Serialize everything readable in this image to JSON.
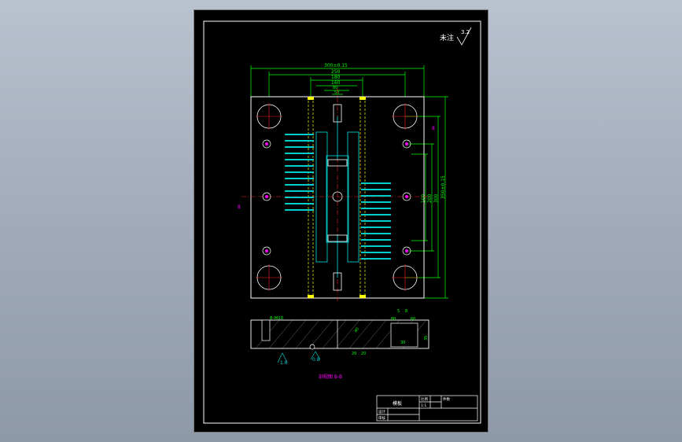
{
  "drawing": {
    "surface_note": "未注",
    "roughness_value": "3.2",
    "dimensions": {
      "overall_width": "300±0.15",
      "width_2": "250",
      "width_3": "180",
      "width_4": "160",
      "width_5": "80",
      "width_6": "50",
      "width_7": "40",
      "width_8": "20",
      "overall_height": "350±0.15",
      "height_2": "300",
      "height_3": "200",
      "height_4": "100",
      "side_8": "8",
      "offset_8": "8",
      "section_thread": "8-M10",
      "section_depth": "30",
      "section_d1": "5",
      "section_d2": "8",
      "section_d3": "80",
      "section_d4": "60",
      "section_d5": "20",
      "section_d6": "20",
      "section_d7": "40",
      "section_d8": "35"
    },
    "roughness_marks": [
      "1.6",
      "0.8"
    ],
    "section_title": "剖视图 B-B",
    "title_block": {
      "name": "模板",
      "scale_label": "比例",
      "scale_value": "1:1",
      "qty_label": "件数",
      "designer_label": "设计",
      "checker_label": "审核"
    }
  },
  "colors": {
    "outline": "#ffffff",
    "dimension": "#00ff00",
    "hidden_line": "#ffff00",
    "center_line": "#ff2020",
    "part": "#00cccc",
    "note": "#ff00ff"
  }
}
